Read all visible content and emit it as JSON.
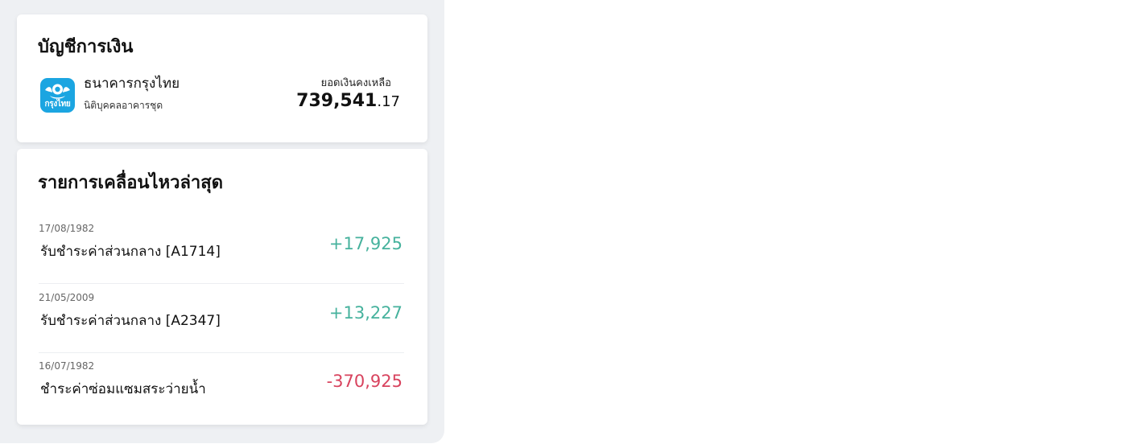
{
  "account_card": {
    "title": "บัญชีการเงิน",
    "bank": {
      "logo_text": "กรุงไทย",
      "logo_color": "#1ba5e1",
      "name": "ธนาคารกรุงไทย",
      "account_holder": "นิติบุคคลอาคารชุด"
    },
    "balance": {
      "label": "ยอดเงินคงเหลือ",
      "integer": "739,541",
      "decimal": ".17"
    }
  },
  "transactions_card": {
    "title": "รายการเคลื่อนไหวล่าสุด",
    "items": [
      {
        "date": "17/08/1982",
        "description": "รับชำระค่าส่วนกลาง [A1714]",
        "amount": "+17,925",
        "type": "income"
      },
      {
        "date": "21/05/2009",
        "description": "รับชำระค่าส่วนกลาง [A2347]",
        "amount": "+13,227",
        "type": "income"
      },
      {
        "date": "16/07/1982",
        "description": "ชำระค่าซ่อมแซมสระว่ายน้ำ",
        "amount": "-370,925",
        "type": "expense"
      }
    ]
  },
  "colors": {
    "income": "#46b29d",
    "expense": "#d8435e",
    "panel_background": "#eef0f3"
  }
}
